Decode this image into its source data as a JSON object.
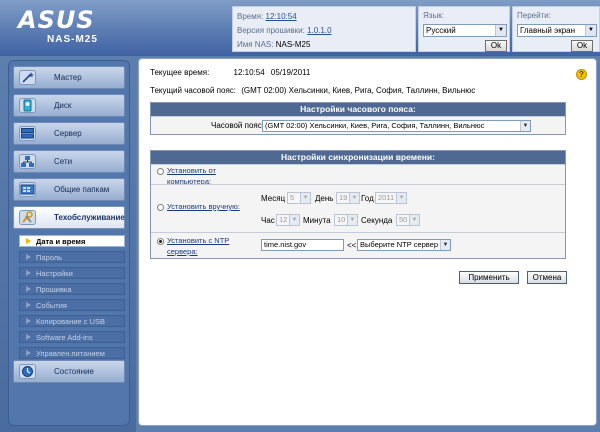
{
  "header": {
    "brand": "ASUS",
    "model": "NAS-M25",
    "time_label": "Время:",
    "time_value": "12:10:54",
    "firmware_label": "Версия прошивки:",
    "firmware_value": "1.0.1.0",
    "nas_name_label": "Имя NAS:",
    "nas_name_value": "NAS-M25",
    "language_label": "Язык:",
    "language_value": "Русский",
    "goto_label": "Перейти:",
    "goto_value": "Главный экран",
    "ok_label": "Ok"
  },
  "sidebar": {
    "items": [
      {
        "label": "Мастер",
        "icon": "wand-icon"
      },
      {
        "label": "Диск",
        "icon": "disk-icon"
      },
      {
        "label": "Сервер",
        "icon": "server-icon"
      },
      {
        "label": "Сети",
        "icon": "network-icon"
      },
      {
        "label": "Общие папкам",
        "icon": "folder-icon"
      },
      {
        "label": "Техобслуживание",
        "icon": "tools-icon"
      },
      {
        "label": "Состояние",
        "icon": "status-icon"
      }
    ],
    "subitems": [
      {
        "label": "Дата и время"
      },
      {
        "label": "Пароль"
      },
      {
        "label": "Настройки"
      },
      {
        "label": "Прошивка"
      },
      {
        "label": "События"
      },
      {
        "label": "Копирование с USB"
      },
      {
        "label": "Software Add-ins"
      },
      {
        "label": "Управлен.питанием"
      }
    ]
  },
  "main": {
    "current_time_label": "Текущее время:",
    "current_time_value": "12:10:54",
    "current_date_value": "05/19/2011",
    "current_tz_label": "Текущий часовой пояс:",
    "current_tz_value": "(GMT 02:00) Хельсинки, Киев, Рига, София, Таллинн, Вильнюс",
    "tz_section": {
      "title": "Настройки часового пояса:",
      "tz_label": "Часовой пояс:",
      "tz_value": "(GMT 02:00) Хельсинки, Киев, Рига, София, Таллинн, Вильнюс"
    },
    "sync_section": {
      "title": "Настройки синхронизации времени:",
      "opt_computer": "Установить от компьютера:",
      "opt_manual": "Установить вручную:",
      "opt_ntp": "Установить с NTP сервера:",
      "month_label": "Месяц",
      "month_value": "5",
      "day_label": "День",
      "day_value": "19",
      "year_label": "Год",
      "year_value": "2011",
      "hour_label": "Час",
      "hour_value": "12",
      "minute_label": "Минута",
      "minute_value": "10",
      "second_label": "Секунда",
      "second_value": "50",
      "ntp_server_value": "time.nist.gov",
      "ntp_arrows": "<<",
      "ntp_select_value": "Выберите NTP сервер",
      "selected_option": "ntp"
    },
    "apply_label": "Применить",
    "cancel_label": "Отмена"
  },
  "colors": {
    "header": "#3f62a3",
    "section_head": "#4f6992",
    "link": "#2c4f9a",
    "active_arrow": "#f2b600"
  }
}
